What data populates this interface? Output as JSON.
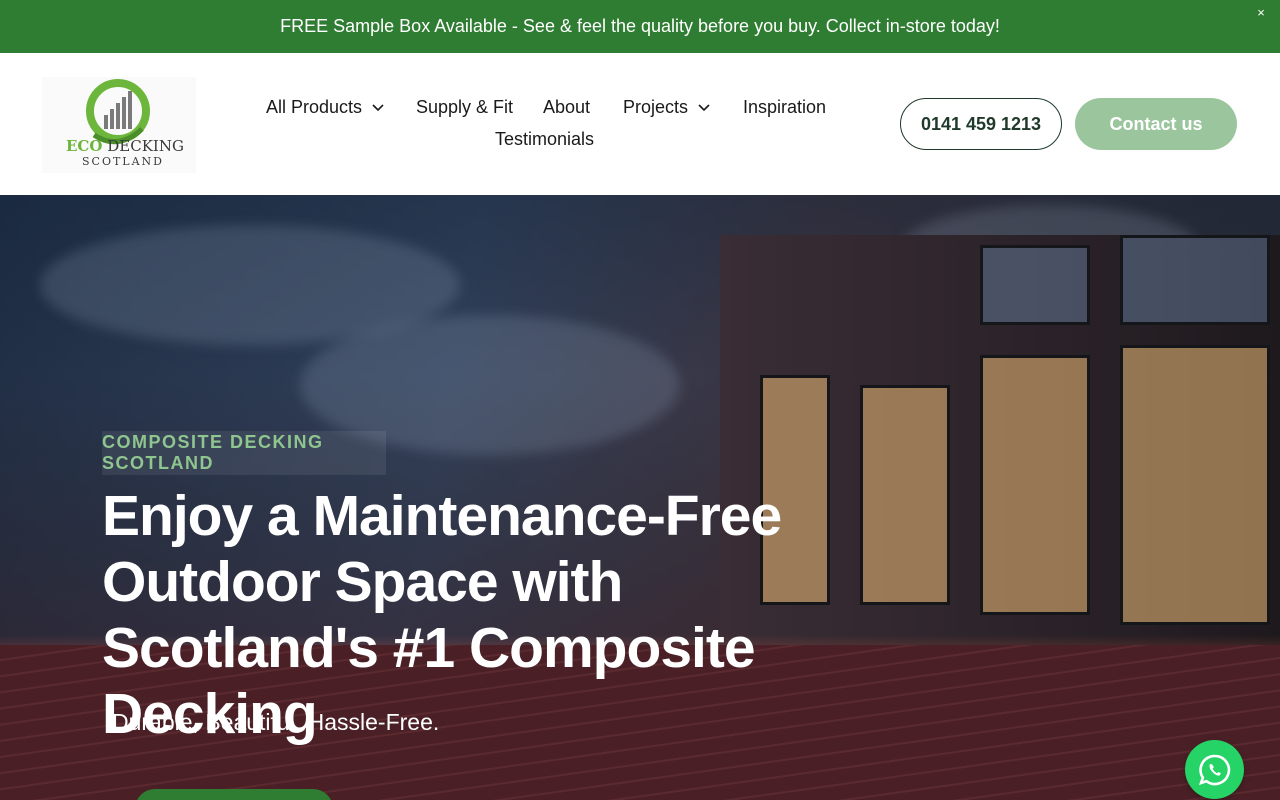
{
  "announcement": {
    "text": "FREE Sample Box Available - See & feel the quality before you buy. Collect in-store today!",
    "close_label": "×",
    "background": "#2f7d32"
  },
  "brand": {
    "logo_eco": "ECO",
    "logo_decking": "DECKING",
    "logo_sub": "SCOTLAND",
    "accent": "#6bb63b"
  },
  "nav": {
    "items": [
      {
        "label": "All Products",
        "has_dropdown": true,
        "icon": "chevron-down-icon"
      },
      {
        "label": "Supply & Fit",
        "has_dropdown": false
      },
      {
        "label": "About",
        "has_dropdown": false
      },
      {
        "label": "Projects",
        "has_dropdown": true,
        "icon": "chevron-down-icon"
      },
      {
        "label": "Inspiration",
        "has_dropdown": false
      },
      {
        "label": "Testimonials",
        "has_dropdown": false
      }
    ]
  },
  "header_actions": {
    "phone_label": "0141 459 1213",
    "contact_label": "Contact us",
    "contact_color": "#9bc59d"
  },
  "hero": {
    "eyebrow": "Composite Decking Scotland",
    "title": "Enjoy a Maintenance-Free Outdoor Space with Scotland's #1 Composite Decking",
    "subtitle": "Durable, Beautiful, Hassle-Free."
  },
  "floating": {
    "whatsapp_icon": "whatsapp-icon",
    "whatsapp_color": "#25d366"
  }
}
